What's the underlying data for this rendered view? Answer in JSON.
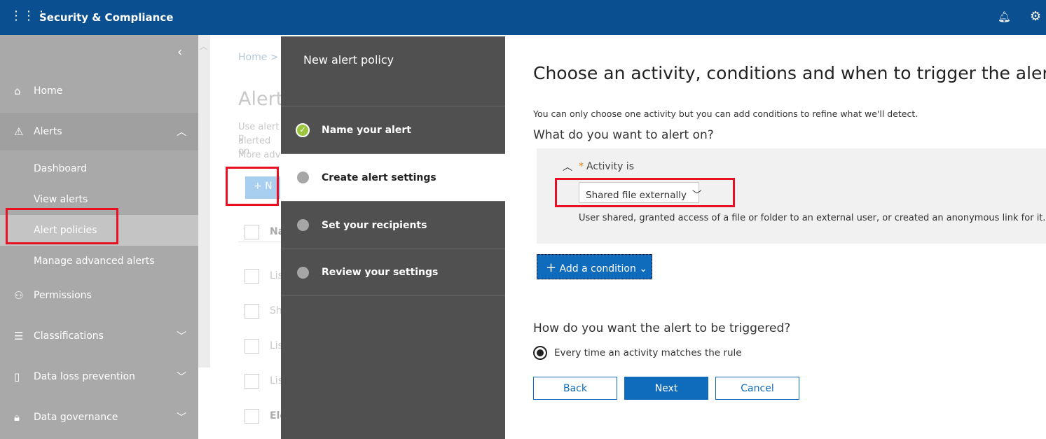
{
  "topbar": {
    "title": "Security & Compliance",
    "icons": [
      "app-launcher-icon",
      "bell-icon",
      "gear-icon"
    ]
  },
  "sidebar": {
    "items": [
      {
        "label": "Home",
        "icon": "home-icon"
      },
      {
        "label": "Alerts",
        "icon": "warning-icon"
      },
      {
        "label": "Permissions",
        "icon": "people-icon"
      },
      {
        "label": "Classifications",
        "icon": "list-icon"
      },
      {
        "label": "Data loss prevention",
        "icon": "document-lock-icon"
      },
      {
        "label": "Data governance",
        "icon": "lock-icon"
      }
    ],
    "alerts_sub": [
      "Dashboard",
      "View alerts",
      "Alert policies",
      "Manage advanced alerts"
    ],
    "selected": "Alert policies"
  },
  "background_page": {
    "breadcrumb": "Home  >",
    "title": "Alert",
    "desc": [
      "Use alert p",
      "alerted on",
      "More adv"
    ],
    "new_button": "+ N",
    "header": "Na",
    "rows": [
      "Lis",
      "Sh",
      "Lis",
      "Lis",
      "Ele"
    ]
  },
  "wizard": {
    "title": "New alert policy",
    "steps": [
      {
        "label": "Name your alert",
        "status": "complete"
      },
      {
        "label": "Create alert settings",
        "status": "current"
      },
      {
        "label": "Set your recipients",
        "status": "pending"
      },
      {
        "label": "Review your settings",
        "status": "pending"
      }
    ]
  },
  "main": {
    "heading": "Choose an activity, conditions and when to trigger the alert",
    "info": "You can only choose one activity but you can add conditions to refine what we'll detect.",
    "question1": "What do you want to alert on?",
    "activity_label": "Activity is",
    "required_mark": "*",
    "activity_value": "Shared file externally",
    "activity_desc": "User shared, granted access of a file or folder to an external user, or created an anonymous link for it.",
    "add_condition": "Add a condition",
    "question2": "How do you want the alert to be triggered?",
    "radio_option": "Every time an activity matches the rule",
    "back": "Back",
    "next": "Next",
    "cancel": "Cancel"
  },
  "colors": {
    "topbar": "#0a4f8f",
    "accent": "#0f6cbd",
    "highlight": "#e81123",
    "wizard_bg": "#505050"
  }
}
